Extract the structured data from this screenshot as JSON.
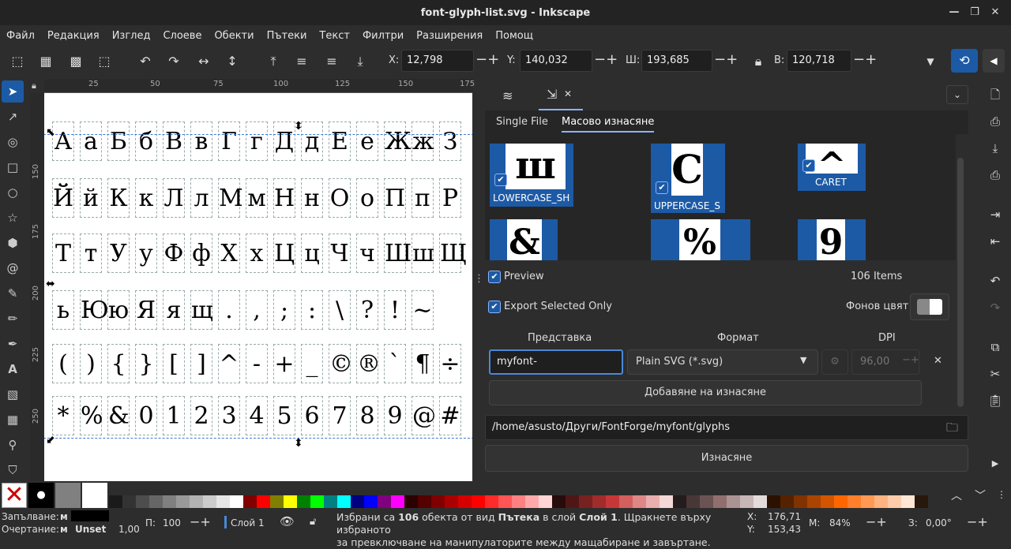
{
  "window": {
    "title": "font-glyph-list.svg - Inkscape"
  },
  "menu": [
    "Файл",
    "Редакция",
    "Изглед",
    "Слоеве",
    "Обекти",
    "Пътеки",
    "Текст",
    "Филтри",
    "Разширения",
    "Помощ"
  ],
  "toolbar": {
    "x_label": "X:",
    "x": "12,798",
    "y_label": "Y:",
    "y": "140,032",
    "w_label": "Ш:",
    "w": "193,685",
    "h_label": "В:",
    "h": "120,718"
  },
  "ruler": {
    "h": [
      "25",
      "50",
      "75",
      "100",
      "125",
      "150",
      "175"
    ],
    "v": [
      "150",
      "175",
      "200",
      "225",
      "250"
    ]
  },
  "glyph_rows": [
    [
      "А",
      "а",
      "Б",
      "б",
      "В",
      "в",
      "Г",
      "г",
      "Д",
      "д",
      "Е",
      "е",
      "Ж",
      "ж",
      "З"
    ],
    [
      "Й",
      "й",
      "К",
      "к",
      "Л",
      "л",
      "М",
      "м",
      "Н",
      "н",
      "О",
      "о",
      "П",
      "п",
      "Р"
    ],
    [
      "Т",
      "т",
      "У",
      "у",
      "Ф",
      "ф",
      "Х",
      "х",
      "Ц",
      "ц",
      "Ч",
      "ч",
      "Ш",
      "ш",
      "Щ"
    ],
    [
      "ь",
      "Ю",
      "ю",
      "Я",
      "я",
      "щ",
      ".",
      ",",
      ";",
      ":",
      "\\",
      "?",
      "!",
      "~"
    ],
    [
      "(",
      ")",
      "{",
      "}",
      "[",
      "]",
      "^",
      "-",
      "+",
      "_",
      "©",
      "®",
      "`",
      "¶",
      "÷"
    ],
    [
      "*",
      "%",
      "&",
      "0",
      "1",
      "2",
      "3",
      "4",
      "5",
      "6",
      "7",
      "8",
      "9",
      "@",
      "#"
    ]
  ],
  "panel": {
    "tabs": {
      "single": "Single File",
      "batch": "Масово изнасяне"
    },
    "thumbs": [
      {
        "label": "LOWERCASE_SH",
        "glyph": "ш"
      },
      {
        "label": "UPPERCASE_S",
        "glyph": "С"
      },
      {
        "label": "CARET",
        "glyph": "^"
      },
      {
        "label": "",
        "glyph": "&"
      },
      {
        "label": "",
        "glyph": "%"
      },
      {
        "label": "",
        "glyph": "9"
      }
    ],
    "preview": "Preview",
    "items": "106 Items",
    "export_selected": "Export Selected Only",
    "bg_color": "Фонов цвят",
    "col_repr": "Представка",
    "col_format": "Формат",
    "col_dpi": "DPI",
    "prefix_value": "myfont-",
    "format_value": "Plain SVG (*.svg)",
    "dpi_value": "96,00",
    "add_export": "Добавяне на изнасяне",
    "path": "/home/asusto/Други/FontForge/myfont/glyphs",
    "export_btn": "Изнасяне"
  },
  "palette_colors": [
    "#1a1a1a",
    "#333333",
    "#4d4d4d",
    "#666666",
    "#808080",
    "#999999",
    "#b3b3b3",
    "#cccccc",
    "#e6e6e6",
    "#ffffff",
    "#800000",
    "#ff0000",
    "#808000",
    "#ffff00",
    "#008000",
    "#00ff00",
    "#008080",
    "#00ffff",
    "#000080",
    "#0000ff",
    "#800080",
    "#ff00ff",
    "#2b0000",
    "#550000",
    "#800000",
    "#aa0000",
    "#d40000",
    "#ff0000",
    "#ff2a2a",
    "#ff5555",
    "#ff8080",
    "#ffaaaa",
    "#ffd5d5",
    "#280b0b",
    "#501616",
    "#782121",
    "#a02c2c",
    "#c83737",
    "#d35f5f",
    "#de8787",
    "#e9afaf",
    "#f4d7d7",
    "#241c1c",
    "#483737",
    "#6c5353",
    "#916f6f",
    "#ac9393",
    "#c8b7b7",
    "#e3dbdb",
    "#2b1100",
    "#552200",
    "#803300",
    "#aa4400",
    "#d45500",
    "#ff6600",
    "#ff7f2a",
    "#ff9955",
    "#ffb380",
    "#ffccaa",
    "#ffe6d5",
    "#28170b"
  ],
  "status": {
    "fill_label": "Запълване:",
    "fill_val": "м",
    "stroke_label": "Очертание:",
    "stroke_val": "м",
    "stroke_unset": "Unset",
    "stroke_w": "1,00",
    "opacity_label": "П:",
    "opacity": "100",
    "layer": "Слой 1",
    "msg1_a": "Избрани са ",
    "msg1_b": "106",
    "msg1_c": " обекта от вид ",
    "msg1_d": "Пътека",
    "msg1_e": " в слой ",
    "msg1_f": "Слой 1",
    "msg1_g": ". Щракнете върху избраното",
    "msg2": "за превключване на манипулаторите между мащабиране и завъртане.",
    "cx_label": "X:",
    "cx": "176,71",
    "cy_label": "Y:",
    "cy": "153,43",
    "zoom_label": "М:",
    "zoom": "84%",
    "rot_label": "З:",
    "rot": "0,00°"
  }
}
